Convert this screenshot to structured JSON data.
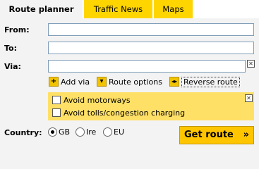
{
  "tabs": [
    {
      "label": "Route planner",
      "active": true
    },
    {
      "label": "Traffic News",
      "active": false
    },
    {
      "label": "Maps",
      "active": false
    }
  ],
  "form": {
    "from_label": "From:",
    "from_value": "",
    "to_label": "To:",
    "to_value": "",
    "via_label": "Via:",
    "via_value": ""
  },
  "actions": {
    "add_via": "Add via",
    "route_options": "Route options",
    "reverse_route": "Reverse route"
  },
  "options": {
    "avoid_motorways": {
      "label": "Avoid motorways",
      "checked": false
    },
    "avoid_tolls": {
      "label": "Avoid tolls/congestion charging",
      "checked": false
    }
  },
  "country": {
    "label": "Country:",
    "choices": [
      {
        "label": "GB",
        "checked": true
      },
      {
        "label": "Ire",
        "checked": false
      },
      {
        "label": "EU",
        "checked": false
      }
    ]
  },
  "submit": {
    "label": "Get route",
    "arrows": "»"
  },
  "colors": {
    "accent": "#ffd500",
    "panel": "#f3f3f3",
    "options_bg": "#ffe066",
    "button": "#ffc600"
  }
}
